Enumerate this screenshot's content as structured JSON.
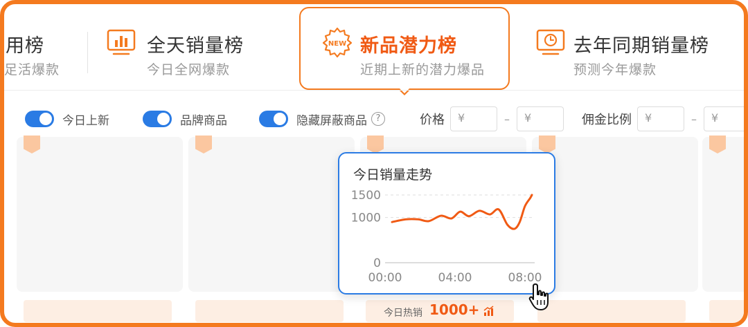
{
  "tabs": [
    {
      "title": "用榜",
      "subtitle": "足活爆款"
    },
    {
      "title": "全天销量榜",
      "subtitle": "今日全网爆款",
      "icon": "bar-chart-icon"
    },
    {
      "title": "新品潜力榜",
      "subtitle": "近期上新的潜力爆品",
      "icon": "new-badge-icon",
      "active": true
    },
    {
      "title": "去年同期销量榜",
      "subtitle": "预测今年爆款",
      "icon": "clock-icon"
    }
  ],
  "filters": {
    "toggle1": "今日上新",
    "toggle2": "品牌商品",
    "toggle3": "隐藏屏蔽商品",
    "help": "?",
    "price_label": "价格",
    "currency": "¥",
    "dash": "–",
    "commission_label": "佣金比例"
  },
  "hot": {
    "label": "今日热销",
    "value": "1000+"
  },
  "popup": {
    "title": "今日销量走势"
  },
  "chart_data": {
    "type": "line",
    "title": "今日销量走势",
    "x_ticks": [
      "00:00",
      "04:00",
      "08:00"
    ],
    "y_ticks": [
      "0",
      "1000",
      "1500"
    ],
    "ylim": [
      0,
      1500
    ],
    "xlim": [
      0,
      8
    ],
    "x": [
      0,
      0.8,
      1.5,
      2.1,
      2.8,
      3.4,
      3.9,
      4.4,
      5.0,
      5.6,
      6.1,
      6.6,
      7.0,
      7.3,
      7.6,
      7.9,
      8.0
    ],
    "values": [
      900,
      960,
      960,
      920,
      1040,
      980,
      1130,
      1030,
      1150,
      1070,
      1180,
      840,
      750,
      900,
      1250,
      1430,
      1500
    ],
    "grid": true,
    "line_color": "#f05a14"
  },
  "colors": {
    "accent": "#f47a1f",
    "active_title": "#f05a14",
    "toggle": "#2a7be4"
  }
}
